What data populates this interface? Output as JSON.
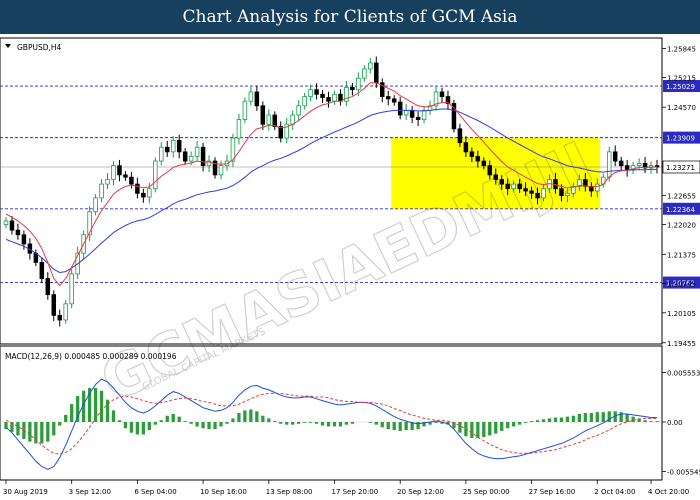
{
  "header": {
    "title": "Chart Analysis for Clients of GCM Asia"
  },
  "watermark": {
    "text": "GCMASIAEDMIJII",
    "sub_text": "GLOBAL CAPITAL MARKETS"
  },
  "colors": {
    "banner_bg": "#16405e",
    "candle_up": "#15a04a",
    "candle_down": "#000000",
    "ma_fast": "#e63946",
    "ma_slow": "#2f3fd6",
    "level_line": "#2b2bc4",
    "highlight_box": "#ffff00",
    "macd_hist": "#2e9c3a",
    "macd_line": "#1f4fd8",
    "signal_line": "#e63946"
  },
  "chart_data": [
    {
      "type": "candlestick",
      "title": "GBPUSD,H4",
      "symbol": "GBPUSD",
      "timeframe": "H4",
      "x_labels": [
        "30 Aug 2019",
        "3 Sep 12:00",
        "6 Sep 04:00",
        "10 Sep 16:00",
        "13 Sep 08:00",
        "17 Sep 20:00",
        "20 Sep 12:00",
        "25 Sep 00:00",
        "27 Sep 16:00",
        "2 Oct 04:00",
        "4 Oct 20:00"
      ],
      "y_ticks": [
        "1.25845",
        "1.25215",
        "1.24570",
        "1.23270",
        "1.22655",
        "1.22020",
        "1.21375",
        "1.20745",
        "1.20105",
        "1.19455"
      ],
      "ylim": [
        1.1945,
        1.2605
      ],
      "current_price": "1.23271",
      "levels": [
        {
          "value": 1.25029,
          "label": "1.25029"
        },
        {
          "value": 1.23909,
          "label": "1.23909"
        },
        {
          "value": 1.22364,
          "label": "1.22364"
        },
        {
          "value": 1.20762,
          "label": "1.20762"
        }
      ],
      "highlight_zone": {
        "from_label": "25 Sep 00:00",
        "to_label": "4 Oct 20:00",
        "price_range": [
          1.22364,
          1.23909
        ]
      },
      "close": [
        1.221,
        1.219,
        1.218,
        1.216,
        1.214,
        1.212,
        1.2085,
        1.205,
        1.2005,
        1.1995,
        1.203,
        1.2095,
        1.214,
        1.218,
        1.223,
        1.226,
        1.229,
        1.23,
        1.233,
        1.231,
        1.2305,
        1.229,
        1.227,
        1.2262,
        1.228,
        1.234,
        1.237,
        1.236,
        1.2385,
        1.236,
        1.234,
        1.235,
        1.237,
        1.233,
        1.234,
        1.231,
        1.233,
        1.234,
        1.239,
        1.243,
        1.247,
        1.249,
        1.246,
        1.242,
        1.244,
        1.2415,
        1.239,
        1.242,
        1.244,
        1.246,
        1.248,
        1.2495,
        1.2485,
        1.2478,
        1.247,
        1.2485,
        1.247,
        1.25,
        1.2495,
        1.252,
        1.254,
        1.2553,
        1.251,
        1.248,
        1.2475,
        1.2468,
        1.244,
        1.245,
        1.2435,
        1.243,
        1.245,
        1.246,
        1.249,
        1.248,
        1.2465,
        1.241,
        1.238,
        1.236,
        1.235,
        1.234,
        1.233,
        1.231,
        1.23,
        1.229,
        1.228,
        1.229,
        1.228,
        1.2275,
        1.227,
        1.226,
        1.228,
        1.23,
        1.228,
        1.2265,
        1.227,
        1.2285,
        1.23,
        1.2285,
        1.2275,
        1.229,
        1.2305,
        1.236,
        1.234,
        1.233,
        1.232,
        1.233,
        1.2335,
        1.2325,
        1.233,
        1.2327
      ],
      "ma_fast": [
        1.2225,
        1.2218,
        1.221,
        1.22,
        1.2188,
        1.2172,
        1.215,
        1.212,
        1.2085,
        1.207,
        1.2085,
        1.211,
        1.2135,
        1.216,
        1.2185,
        1.221,
        1.2232,
        1.225,
        1.2268,
        1.2278,
        1.2285,
        1.2288,
        1.2285,
        1.2282,
        1.2284,
        1.2295,
        1.2307,
        1.2316,
        1.2326,
        1.2331,
        1.2333,
        1.2336,
        1.234,
        1.2338,
        1.2338,
        1.2334,
        1.2333,
        1.2334,
        1.2343,
        1.236,
        1.238,
        1.2398,
        1.241,
        1.2413,
        1.2418,
        1.2417,
        1.2412,
        1.2414,
        1.242,
        1.2428,
        1.2438,
        1.2448,
        1.2456,
        1.2462,
        1.2465,
        1.247,
        1.247,
        1.2476,
        1.248,
        1.2488,
        1.2498,
        1.251,
        1.251,
        1.2504,
        1.2498,
        1.2492,
        1.2482,
        1.2475,
        1.2467,
        1.246,
        1.2458,
        1.2458,
        1.2464,
        1.2467,
        1.2467,
        1.2456,
        1.244,
        1.2424,
        1.2409,
        1.2395,
        1.2381,
        1.2366,
        1.2352,
        1.2339,
        1.2327,
        1.232,
        1.2312,
        1.2305,
        1.2298,
        1.2291,
        1.2289,
        1.2291,
        1.2289,
        1.2285,
        1.2282,
        1.2283,
        1.2287,
        1.2286,
        1.2284,
        1.2285,
        1.2289,
        1.2306,
        1.2315,
        1.2319,
        1.232,
        1.2323,
        1.2326,
        1.2326,
        1.2327,
        1.2327
      ],
      "ma_slow": [
        1.217,
        1.2165,
        1.216,
        1.2155,
        1.2148,
        1.214,
        1.213,
        1.2118,
        1.2105,
        1.2098,
        1.21,
        1.2108,
        1.2117,
        1.2127,
        1.2138,
        1.215,
        1.2162,
        1.2173,
        1.2185,
        1.2193,
        1.22,
        1.2206,
        1.221,
        1.2213,
        1.2217,
        1.2224,
        1.2232,
        1.2239,
        1.2247,
        1.2253,
        1.2257,
        1.2262,
        1.2267,
        1.227,
        1.2273,
        1.2275,
        1.2278,
        1.2281,
        1.2287,
        1.2295,
        1.2305,
        1.2316,
        1.2324,
        1.233,
        1.2337,
        1.2342,
        1.2346,
        1.2351,
        1.2357,
        1.2363,
        1.237,
        1.2378,
        1.2385,
        1.2391,
        1.2397,
        1.2403,
        1.2408,
        1.2414,
        1.2419,
        1.2425,
        1.2432,
        1.2439,
        1.2443,
        1.2446,
        1.2448,
        1.245,
        1.245,
        1.245,
        1.245,
        1.2449,
        1.2449,
        1.245,
        1.2452,
        1.2453,
        1.2453,
        1.245,
        1.2446,
        1.244,
        1.2434,
        1.2428,
        1.2421,
        1.2414,
        1.2406,
        1.2398,
        1.239,
        1.2383,
        1.2376,
        1.2369,
        1.2362,
        1.2355,
        1.2349,
        1.2345,
        1.234,
        1.2335,
        1.233,
        1.2327,
        1.2325,
        1.2322,
        1.2319,
        1.2317,
        1.2316,
        1.2318,
        1.2319,
        1.232,
        1.232,
        1.2321,
        1.2321,
        1.2321,
        1.2322,
        1.2322
      ]
    },
    {
      "type": "line",
      "title": "MACD(12,26,9) 0.000485 0.000289 0.000196",
      "y_ticks": [
        "0.005553",
        "0.00",
        "-0.005545"
      ],
      "ylim": [
        -0.0056,
        0.0056
      ],
      "series": [
        {
          "name": "MACD",
          "values": [
            -0.0006,
            -0.0012,
            -0.002,
            -0.0028,
            -0.0036,
            -0.0044,
            -0.005,
            -0.0053,
            -0.005,
            -0.004,
            -0.0026,
            -0.001,
            0.0006,
            0.002,
            0.0032,
            0.0042,
            0.0048,
            0.0045,
            0.0038,
            0.003,
            0.0022,
            0.0016,
            0.0012,
            0.001,
            0.0013,
            0.0018,
            0.0024,
            0.003,
            0.0034,
            0.0032,
            0.0028,
            0.0024,
            0.002,
            0.0016,
            0.0014,
            0.0012,
            0.0013,
            0.0016,
            0.0022,
            0.003,
            0.0036,
            0.004,
            0.0041,
            0.0038,
            0.0036,
            0.0033,
            0.003,
            0.0028,
            0.0027,
            0.0027,
            0.0028,
            0.0028,
            0.0026,
            0.0024,
            0.0022,
            0.002,
            0.0019,
            0.002,
            0.0021,
            0.0022,
            0.0022,
            0.0021,
            0.0018,
            0.0014,
            0.001,
            0.0006,
            0.0003,
            0.0001,
            -0.0001,
            -0.0002,
            -0.0001,
            0.0,
            0.0001,
            0.0,
            -0.0002,
            -0.0008,
            -0.0016,
            -0.0024,
            -0.003,
            -0.0035,
            -0.0038,
            -0.004,
            -0.0041,
            -0.0041,
            -0.004,
            -0.0039,
            -0.0038,
            -0.0036,
            -0.0034,
            -0.0032,
            -0.003,
            -0.0028,
            -0.0026,
            -0.0024,
            -0.0021,
            -0.0018,
            -0.0014,
            -0.001,
            -0.0007,
            -0.0004,
            -0.0001,
            0.0003,
            0.0007,
            0.0009,
            0.0009,
            0.0008,
            0.0007,
            0.0006,
            0.0005,
            0.0005
          ]
        },
        {
          "name": "Signal",
          "values": [
            0.0002,
            -0.0001,
            -0.0005,
            -0.0009,
            -0.0014,
            -0.002,
            -0.0026,
            -0.0031,
            -0.0035,
            -0.0036,
            -0.0034,
            -0.003,
            -0.0023,
            -0.0015,
            -0.0006,
            0.0004,
            0.0013,
            0.002,
            0.0025,
            0.0028,
            0.0029,
            0.0028,
            0.0026,
            0.0024,
            0.0022,
            0.0021,
            0.0022,
            0.0023,
            0.0025,
            0.0026,
            0.0027,
            0.0026,
            0.0025,
            0.0023,
            0.0022,
            0.002,
            0.0018,
            0.0018,
            0.0018,
            0.002,
            0.0023,
            0.0026,
            0.0029,
            0.0031,
            0.0032,
            0.0032,
            0.0032,
            0.0031,
            0.003,
            0.0029,
            0.0029,
            0.0029,
            0.0028,
            0.0028,
            0.0027,
            0.0025,
            0.0024,
            0.0023,
            0.0023,
            0.0022,
            0.0022,
            0.0022,
            0.0021,
            0.002,
            0.0018,
            0.0015,
            0.0013,
            0.001,
            0.0008,
            0.0006,
            0.0004,
            0.0003,
            0.0002,
            0.0002,
            0.0001,
            -0.0001,
            -0.0004,
            -0.0008,
            -0.0012,
            -0.0017,
            -0.0021,
            -0.0025,
            -0.0028,
            -0.0031,
            -0.0033,
            -0.0034,
            -0.0035,
            -0.0035,
            -0.0035,
            -0.0034,
            -0.0033,
            -0.0032,
            -0.0031,
            -0.0029,
            -0.0027,
            -0.0025,
            -0.0023,
            -0.002,
            -0.0017,
            -0.0015,
            -0.0012,
            -0.0009,
            -0.0005,
            -0.0002,
            0.0,
            0.0002,
            0.0003,
            0.0004,
            0.0004,
            0.0004
          ]
        }
      ]
    }
  ]
}
